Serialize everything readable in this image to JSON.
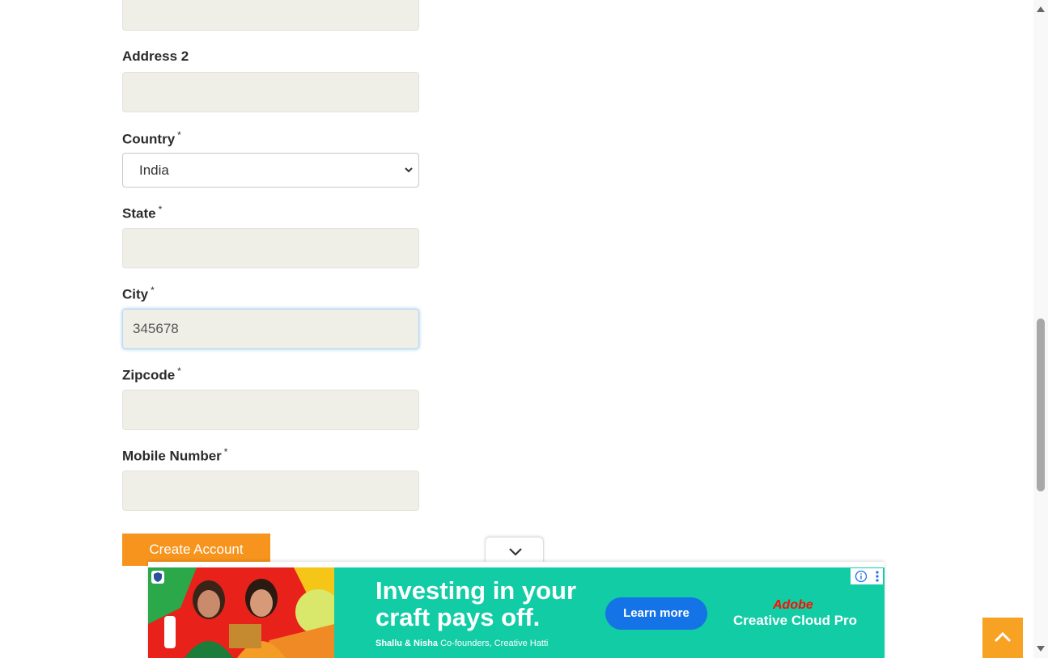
{
  "form": {
    "address2_label": "Address 2",
    "country_label": "Country",
    "country_value": "India",
    "state_label": "State",
    "city_label": "City",
    "city_value": "345678",
    "zipcode_label": "Zipcode",
    "mobile_label": "Mobile Number",
    "required_mark": "*",
    "submit_label": "Create Account"
  },
  "ad": {
    "headline_line1": "Investing in your",
    "headline_line2": "craft pays off.",
    "sub_names": "Shallu & Nisha",
    "sub_role": "Co-founders, Creative Hatti",
    "cta_label": "Learn more",
    "brand_name": "Adobe",
    "product_name": "Creative Cloud Pro"
  },
  "colors": {
    "accent": "#f7941d",
    "input_bg": "#efefe8",
    "ad_bg": "#12cca6",
    "ad_button": "#1473e6",
    "adobe_red": "#fa0f00"
  },
  "icons": {
    "select": "chevron-down-icon",
    "collapse": "chevron-down-icon",
    "scroll_top": "chevron-up-icon",
    "ad_info": "info-icon",
    "ad_menu": "kebab-menu-icon"
  }
}
